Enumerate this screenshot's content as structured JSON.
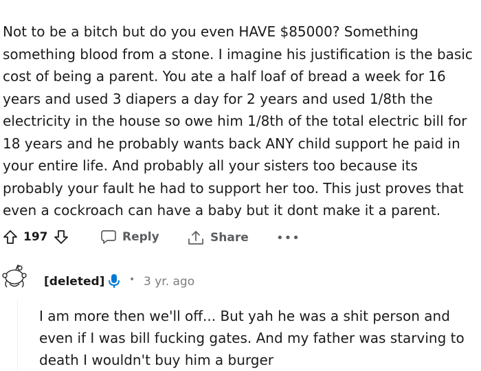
{
  "top_fragment": {
    "text": "— • • • •"
  },
  "comment": {
    "body": "Not to be a bitch but do you even HAVE $85000? Something something blood from a stone. I imagine his justification is the basic cost of being a parent. You ate a half loaf of bread a week for 16 years and used 3 diapers a day for 2 years and used 1/8th the electricity in the house so owe him 1/8th of the total electric bill for 18 years and he probably wants back ANY child support he paid in your entire life. And probably all your sisters too because its probably your fault he had to support her too. This just proves that even a cockroach can have a baby but it dont make it a parent."
  },
  "actions": {
    "vote_count": "197",
    "reply_label": "Reply",
    "share_label": "Share",
    "more_label": "•••"
  },
  "reply": {
    "author": "[deleted]",
    "separator": "•",
    "age": "3 yr. ago",
    "body": "I am more then we'll off... But yah he was a shit person and even if I was bill fucking gates. And my father was starving to death I wouldn't buy him a burger"
  },
  "icons": {
    "upvote": "arrow-up-outline-icon",
    "downvote": "arrow-down-outline-icon",
    "reply": "speech-bubble-icon",
    "share": "share-arrow-icon",
    "more": "ellipsis-icon",
    "mic": "microphone-icon",
    "avatar": "default-snoo-avatar"
  },
  "colors": {
    "text": "#1a1a1b",
    "muted": "#5a5d5f",
    "meta": "#7c7c7c",
    "mic_blue": "#0079d3"
  }
}
